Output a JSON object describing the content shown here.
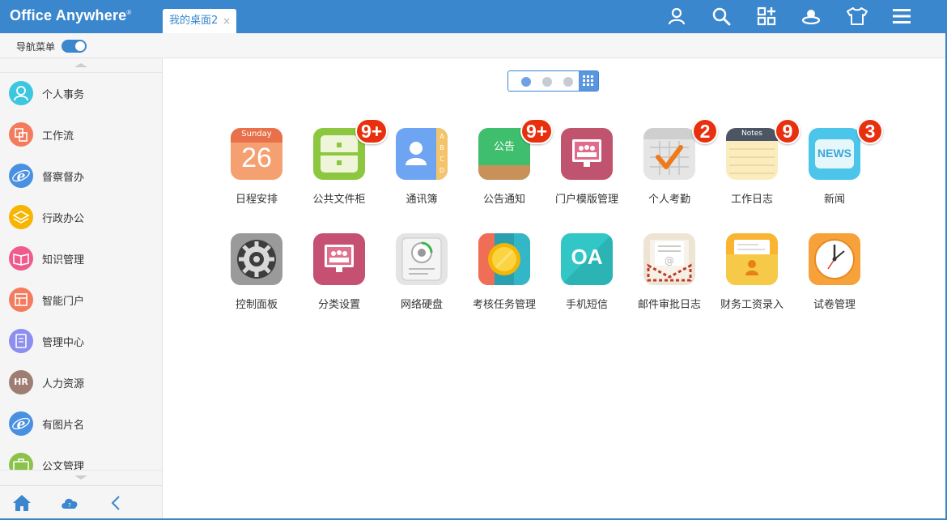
{
  "header": {
    "logo": "Office Anywhere",
    "logo_mark": "®",
    "tab_label": "我的桌面2",
    "tab_close": "×",
    "icons": [
      "user-icon",
      "search-icon",
      "apps-add-icon",
      "cloud-avatar-icon",
      "skin-shirt-icon",
      "menu-icon"
    ]
  },
  "subbar": {
    "nav_menu_label": "导航菜单",
    "toggle_on": true
  },
  "sidebar": {
    "items": [
      {
        "label": "个人事务",
        "icon": "person-icon",
        "color": "#3cc6e0"
      },
      {
        "label": "工作流",
        "icon": "workflow-icon",
        "color": "#f47c5e"
      },
      {
        "label": "督察督办",
        "icon": "ie-icon",
        "color": "#4a90e2"
      },
      {
        "label": "行政办公",
        "icon": "layers-icon",
        "color": "#f7b500"
      },
      {
        "label": "知识管理",
        "icon": "book-icon",
        "color": "#ef5b8c"
      },
      {
        "label": "智能门户",
        "icon": "portal-icon",
        "color": "#f47c5e"
      },
      {
        "label": "管理中心",
        "icon": "document-icon",
        "color": "#8c8ef0"
      },
      {
        "label": "人力资源",
        "icon": "hr-icon",
        "color": "#9e7e72",
        "text": "HR"
      },
      {
        "label": "有图片名",
        "icon": "ie-icon",
        "color": "#4a90e2"
      },
      {
        "label": "公文管理",
        "icon": "briefcase-icon",
        "color": "#8bc34a"
      }
    ],
    "footer_icons": [
      "home-icon",
      "cloud-help-icon",
      "collapse-arrow-icon"
    ]
  },
  "desktop": {
    "pager_dots": 3,
    "active_dot": 0,
    "apps": [
      {
        "label": "日程安排",
        "icon": "calendar-icon",
        "weekday": "Sunday",
        "day": "26",
        "badge": ""
      },
      {
        "label": "公共文件柜",
        "icon": "file-cabinet-icon",
        "badge": "9+"
      },
      {
        "label": "通讯簿",
        "icon": "address-book-icon",
        "tabs": [
          "A",
          "B",
          "C",
          "D"
        ],
        "badge": ""
      },
      {
        "label": "公告通知",
        "icon": "notice-board-icon",
        "board_text": "公告",
        "badge": "9+"
      },
      {
        "label": "门户模版管理",
        "icon": "portal-template-icon",
        "badge": ""
      },
      {
        "label": "个人考勤",
        "icon": "attendance-icon",
        "badge": "2"
      },
      {
        "label": "工作日志",
        "icon": "notes-icon",
        "notes_text": "Notes",
        "badge": "9"
      },
      {
        "label": "新闻",
        "icon": "news-icon",
        "news_text": "NEWS",
        "badge": "3"
      },
      {
        "label": "控制面板",
        "icon": "settings-gear-icon",
        "badge": ""
      },
      {
        "label": "分类设置",
        "icon": "category-settings-icon",
        "badge": ""
      },
      {
        "label": "网络硬盘",
        "icon": "network-disk-icon",
        "badge": ""
      },
      {
        "label": "考核任务管理",
        "icon": "medal-icon",
        "badge": ""
      },
      {
        "label": "手机短信",
        "icon": "oa-sms-icon",
        "oa_text": "OA",
        "badge": ""
      },
      {
        "label": "邮件审批日志",
        "icon": "mail-envelope-icon",
        "badge": ""
      },
      {
        "label": "财务工资录入",
        "icon": "payroll-icon",
        "badge": ""
      },
      {
        "label": "试卷管理",
        "icon": "clock-icon",
        "badge": ""
      }
    ]
  }
}
